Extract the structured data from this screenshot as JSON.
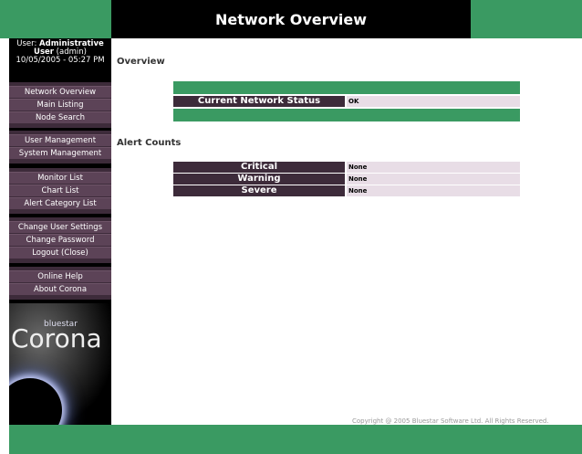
{
  "header": {
    "title": "Network Overview"
  },
  "user": {
    "prefix": "User:",
    "name": "Administrative User",
    "login": "(admin)",
    "datetime": "10/05/2005 - 05:27 PM"
  },
  "nav": {
    "group1": [
      "Network Overview",
      "Main Listing",
      "Node Search"
    ],
    "group2": [
      "User Management",
      "System Management"
    ],
    "group3": [
      "Monitor List",
      "Chart List",
      "Alert Category List"
    ],
    "group4": [
      "Change User Settings",
      "Change Password",
      "Logout (Close)"
    ],
    "group5": [
      "Online Help",
      "About Corona"
    ]
  },
  "logo": {
    "small": "bluestar",
    "big": "Corona"
  },
  "overview": {
    "heading": "Overview",
    "status_label": "Current Network Status",
    "status_value": "OK"
  },
  "alerts": {
    "heading": "Alert Counts",
    "rows": [
      {
        "label": "Critical",
        "value": "None"
      },
      {
        "label": "Warning",
        "value": "None"
      },
      {
        "label": "Severe",
        "value": "None"
      }
    ]
  },
  "footer": {
    "copyright": "Copyright @ 2005 Bluestar Software Ltd. All Rights Reserved."
  },
  "colors": {
    "green": "#3a9a62",
    "purple_dark": "#3d2b3a",
    "purple_mid": "#5c4357",
    "value_bg": "#e8dde6"
  }
}
